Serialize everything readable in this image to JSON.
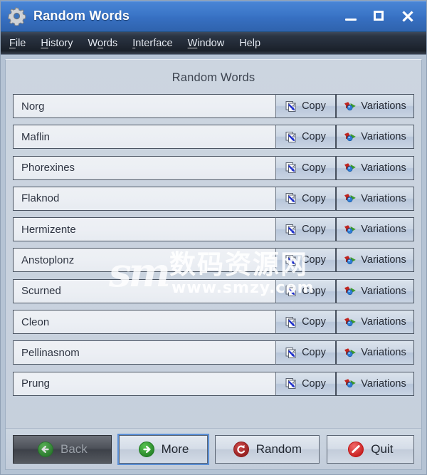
{
  "window": {
    "title": "Random Words",
    "app_icon": "gear-icon",
    "controls": {
      "minimize": "minimize-icon",
      "maximize": "maximize-icon",
      "close": "close-icon"
    },
    "accent_color": "#3b76c8",
    "titlebar_text_color": "#ffffff"
  },
  "menubar": {
    "items": [
      {
        "label": "File",
        "mnemonic_index": 0
      },
      {
        "label": "History",
        "mnemonic_index": 0
      },
      {
        "label": "Words",
        "mnemonic_index": 1
      },
      {
        "label": "Interface",
        "mnemonic_index": 0
      },
      {
        "label": "Window",
        "mnemonic_index": 0
      },
      {
        "label": "Help",
        "mnemonic_index": -1
      }
    ]
  },
  "main": {
    "heading": "Random Words",
    "row_buttons": {
      "copy_label": "Copy",
      "copy_icon": "copy-document-icon",
      "variations_label": "Variations",
      "variations_icon": "variations-spheres-icon"
    },
    "words": [
      "Norg",
      "Maflin",
      "Phorexines",
      "Flaknod",
      "Hermizente",
      "Anstoplonz",
      "Scurned",
      "Cleon",
      "Pellinasnom",
      "Prung"
    ]
  },
  "footer": {
    "buttons": [
      {
        "label": "Back",
        "icon": "arrow-left-circle-icon",
        "state": "disabled",
        "icon_color": "#2e9431"
      },
      {
        "label": "More",
        "icon": "arrow-right-circle-icon",
        "state": "focused",
        "icon_color": "#2e9431"
      },
      {
        "label": "Random",
        "icon": "refresh-circle-icon",
        "state": "normal",
        "icon_color": "#9c2020"
      },
      {
        "label": "Quit",
        "icon": "no-entry-circle-icon",
        "state": "normal",
        "icon_color": "#df2323"
      }
    ]
  },
  "watermark": {
    "logo": "sm",
    "chinese": "数码资源网",
    "url": "www.smzy.com"
  }
}
